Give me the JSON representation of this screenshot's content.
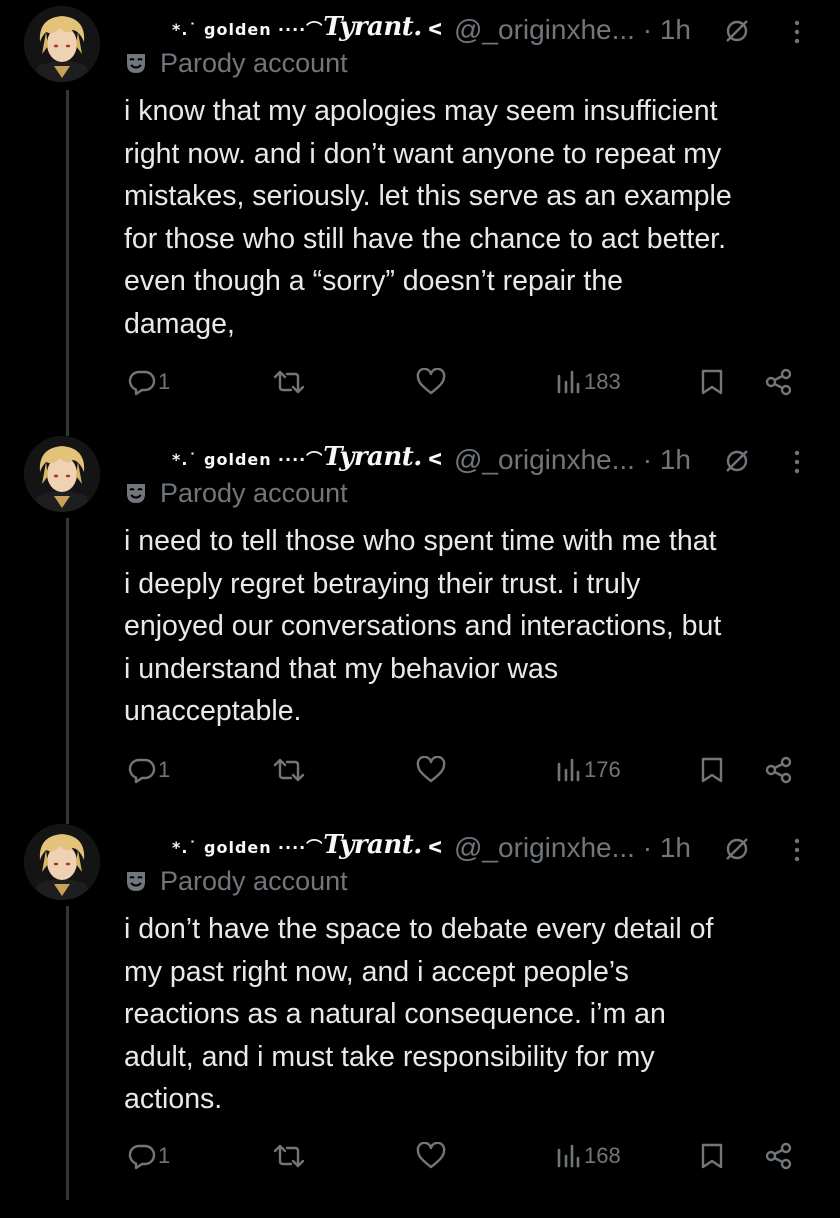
{
  "tweets": [
    {
      "display_name_prefix": "*.˙ golden",
      "display_name_dots": "····⌒",
      "display_name_main": "Tyrant.",
      "display_name_suffix": "ᐸ",
      "handle": "@_originxhe...",
      "time": "1h",
      "parody_label": "Parody account",
      "text": "i know that my apologies may seem insufficient\nright now. and i don’t want anyone to repeat my\nmistakes, seriously. let this serve as an example\nfor those who still have the chance to act better.\neven though a “sorry” doesn’t repair the\ndamage,",
      "replies": "1",
      "views": "183"
    },
    {
      "display_name_prefix": "*.˙ golden",
      "display_name_dots": "····⌒",
      "display_name_main": "Tyrant.",
      "display_name_suffix": "ᐸ",
      "handle": "@_originxhe...",
      "time": "1h",
      "parody_label": "Parody account",
      "text": "i need to tell those who spent time with me that\ni deeply regret betraying their trust. i truly\nenjoyed our conversations and interactions, but\ni understand that my behavior was\nunacceptable.",
      "replies": "1",
      "views": "176"
    },
    {
      "display_name_prefix": "*.˙ golden",
      "display_name_dots": "····⌒",
      "display_name_main": "Tyrant.",
      "display_name_suffix": "ᐸ",
      "handle": "@_originxhe...",
      "time": "1h",
      "parody_label": "Parody account",
      "text": "i don’t have the space to debate every detail of\nmy past right now, and i accept people’s\nreactions as a natural consequence. i’m an\nadult, and i must take responsibility for my\nactions.",
      "replies": "1",
      "views": "168"
    }
  ],
  "icons": {
    "reply": "reply-icon",
    "retweet": "retweet-icon",
    "like": "heart-icon",
    "views": "views-icon",
    "bookmark": "bookmark-icon",
    "share": "share-icon",
    "mute": "mute-icon",
    "more": "more-icon",
    "parody": "parody-mask-icon"
  },
  "colors": {
    "background": "#000000",
    "text": "#e7e9ea",
    "secondary": "#71767b",
    "thread_line": "#333639"
  }
}
